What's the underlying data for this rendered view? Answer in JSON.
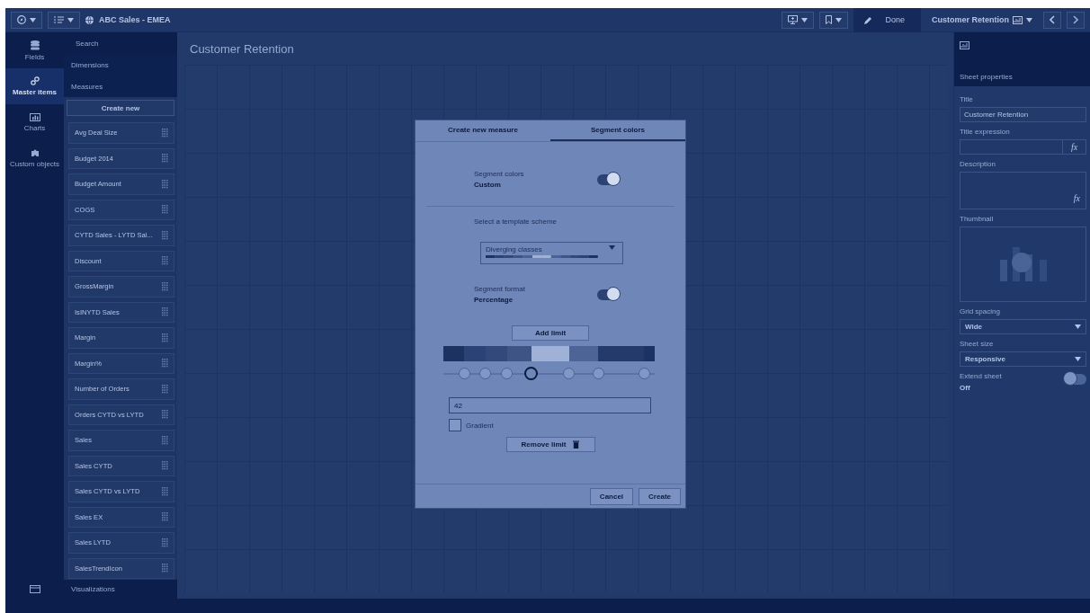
{
  "topbar": {
    "app_title": "ABC Sales - EMEA",
    "done_label": "Done",
    "sheet_title": "Customer Retention"
  },
  "rail": {
    "items": [
      {
        "kind": "fields",
        "label": "Fields",
        "selected": false
      },
      {
        "kind": "master",
        "label": "Master items",
        "selected": true
      },
      {
        "kind": "charts",
        "label": "Charts",
        "selected": false
      },
      {
        "kind": "custom",
        "label": "Custom objects",
        "selected": false
      }
    ]
  },
  "panel": {
    "search_placeholder": "Search",
    "sections": [
      "Dimensions",
      "Measures"
    ],
    "create_button": "Create new",
    "items": [
      "Avg Deal Size",
      "Budget 2014",
      "Budget Amount",
      "COGS",
      "CYTD Sales - LYTD Sal...",
      "Discount",
      "GrossMargin",
      "IsINYTD Sales",
      "Margin",
      "Margin%",
      "Number of Orders",
      "Orders CYTD vs LYTD",
      "Sales",
      "Sales CYTD",
      "Sales CYTD vs LYTD",
      "Sales EX",
      "Sales LYTD",
      "SalesTrendIcon"
    ],
    "footer": "Visualizations"
  },
  "canvas": {
    "title": "Customer Retention"
  },
  "properties": {
    "header": "Sheet properties",
    "title_label": "Title",
    "title_value": "Customer Retention",
    "expression_label": "Title expression",
    "expression_button": "fx",
    "description_label": "Description",
    "description_button": "fx",
    "thumbnail_label": "Thumbnail",
    "grid_label": "Grid spacing",
    "grid_value": "Wide",
    "size_label": "Sheet size",
    "size_value": "Responsive",
    "extend_label": "Extend sheet",
    "extend_value": "Off",
    "extend_on": false
  },
  "dialog": {
    "tabs": [
      {
        "label": "Create new measure",
        "selected": false
      },
      {
        "label": "Segment colors",
        "selected": true
      }
    ],
    "segment_colors": {
      "label": "Segment colors",
      "value": "Custom",
      "on": true
    },
    "scheme_label": "Select a template scheme",
    "scheme_value": "Diverging classes",
    "segment_format": {
      "label": "Segment format",
      "value": "Percentage",
      "on": true
    },
    "add_button": "Add limit",
    "segments": [
      {
        "color": "#1c3261"
      },
      {
        "color": "#2a4275"
      },
      {
        "color": "#33497c"
      },
      {
        "color": "#3d5485"
      },
      {
        "color": "#9fb1d6"
      },
      {
        "color": "#4d6596"
      },
      {
        "color": "#233a6b"
      },
      {
        "color": "#1c3262"
      }
    ],
    "limits": [
      {
        "selected": false
      },
      {
        "selected": false
      },
      {
        "selected": false
      },
      {
        "selected": true
      },
      {
        "selected": false
      },
      {
        "selected": false
      },
      {
        "selected": false
      }
    ],
    "limit_value": "42",
    "gradient": {
      "label": "Gradient",
      "checked": false
    },
    "remove_button": "Remove limit",
    "buttons": [
      "Cancel",
      "Create"
    ]
  }
}
